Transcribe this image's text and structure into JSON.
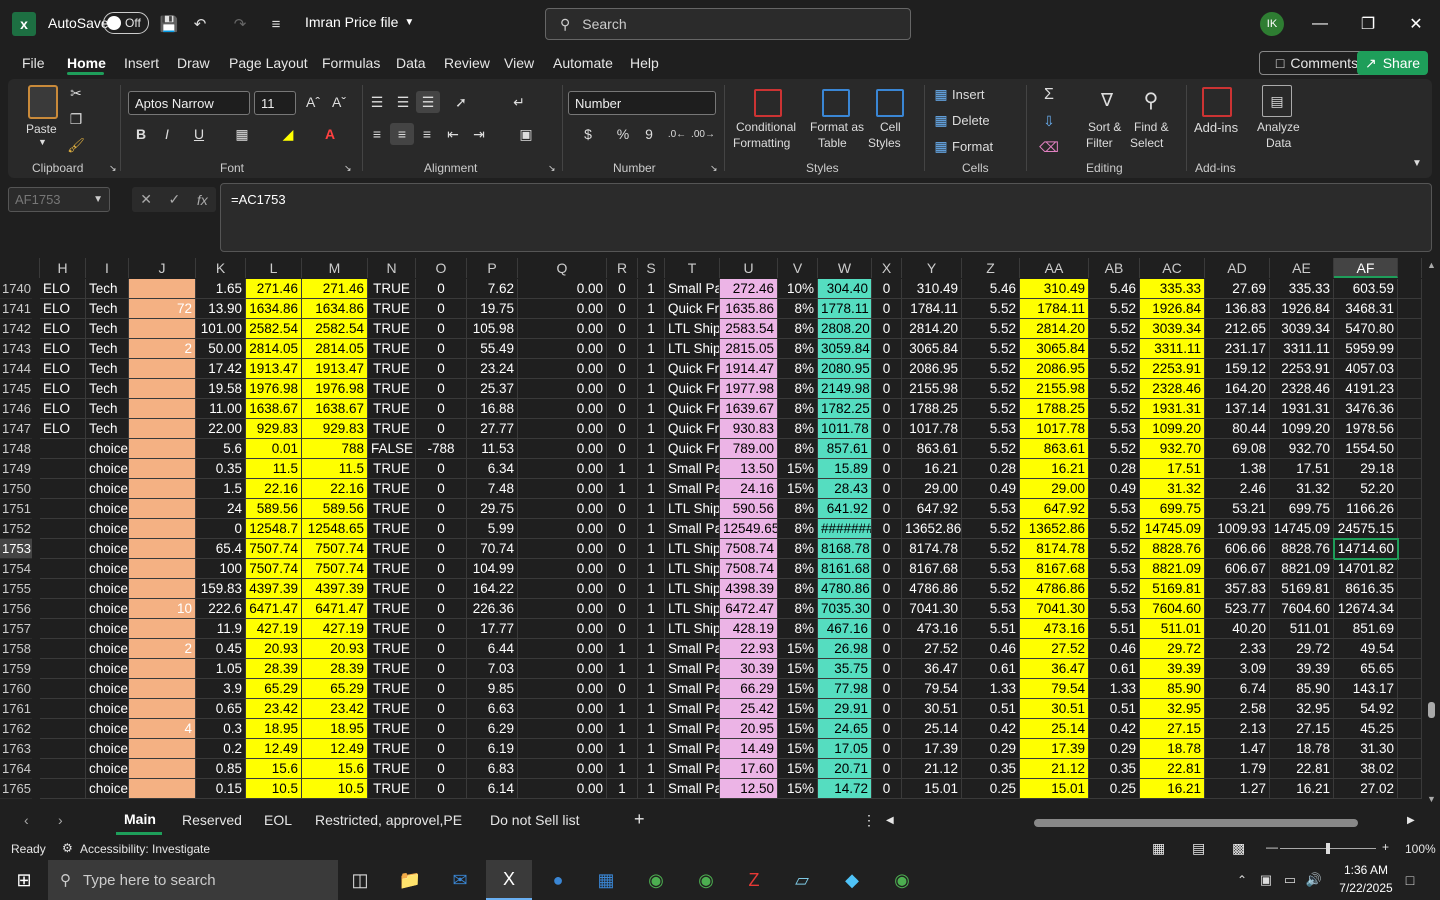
{
  "titlebar": {
    "autosave_label": "AutoSave",
    "autosave_state": "Off",
    "file_name": "Imran Price file",
    "search_placeholder": "Search",
    "user_initials": "IK"
  },
  "menu": {
    "items": [
      "File",
      "Home",
      "Insert",
      "Draw",
      "Page Layout",
      "Formulas",
      "Data",
      "Review",
      "View",
      "Automate",
      "Help"
    ],
    "active": "Home",
    "comments": "Comments",
    "share": "Share"
  },
  "ribbon": {
    "clipboard": {
      "paste": "Paste",
      "group": "Clipboard"
    },
    "font": {
      "name": "Aptos Narrow",
      "size": "11",
      "group": "Font"
    },
    "alignment": {
      "group": "Alignment"
    },
    "number": {
      "format": "Number",
      "group": "Number"
    },
    "styles": {
      "conditional": "Conditional",
      "conditional2": "Formatting",
      "format_as": "Format as",
      "format_as2": "Table",
      "cell": "Cell",
      "cell2": "Styles",
      "group": "Styles"
    },
    "cells": {
      "insert": "Insert",
      "delete": "Delete",
      "format": "Format",
      "group": "Cells"
    },
    "editing": {
      "sort": "Sort &",
      "sort2": "Filter",
      "find": "Find &",
      "find2": "Select",
      "group": "Editing"
    },
    "addins": {
      "addins": "Add-ins",
      "analyze": "Analyze",
      "analyze2": "Data",
      "group": "Add-ins"
    }
  },
  "formula_bar": {
    "name_box": "AF1753",
    "formula": "=AC1753"
  },
  "grid": {
    "columns": [
      "H",
      "I",
      "J",
      "K",
      "L",
      "M",
      "N",
      "O",
      "P",
      "Q",
      "R",
      "S",
      "T",
      "U",
      "V",
      "W",
      "X",
      "Y",
      "Z",
      "AA",
      "AB",
      "AC",
      "AD",
      "AE",
      "AF"
    ],
    "selected_column": "AF",
    "selected_row": "1753",
    "rows": [
      {
        "n": "1740",
        "c": [
          "ELO",
          "Tech",
          "",
          "1.65",
          "271.46",
          "271.46",
          "TRUE",
          "0",
          "7.62",
          "0.00",
          "0",
          "1",
          "Small Pa",
          "272.46",
          "10%",
          "304.40",
          "0",
          "310.49",
          "5.46",
          "310.49",
          "5.46",
          "335.33",
          "27.69",
          "335.33",
          "603.59"
        ]
      },
      {
        "n": "1741",
        "c": [
          "ELO",
          "Tech",
          "72",
          "13.90",
          "1634.86",
          "1634.86",
          "TRUE",
          "0",
          "19.75",
          "0.00",
          "0",
          "1",
          "Quick Fr",
          "1635.86",
          "8%",
          "1778.11",
          "0",
          "1784.11",
          "5.52",
          "1784.11",
          "5.52",
          "1926.84",
          "136.83",
          "1926.84",
          "3468.31"
        ]
      },
      {
        "n": "1742",
        "c": [
          "ELO",
          "Tech",
          "",
          "101.00",
          "2582.54",
          "2582.54",
          "TRUE",
          "0",
          "105.98",
          "0.00",
          "0",
          "1",
          "LTL Ship",
          "2583.54",
          "8%",
          "2808.20",
          "0",
          "2814.20",
          "5.52",
          "2814.20",
          "5.52",
          "3039.34",
          "212.65",
          "3039.34",
          "5470.80"
        ]
      },
      {
        "n": "1743",
        "c": [
          "ELO",
          "Tech",
          "2",
          "50.00",
          "2814.05",
          "2814.05",
          "TRUE",
          "0",
          "55.49",
          "0.00",
          "0",
          "1",
          "LTL Ship",
          "2815.05",
          "8%",
          "3059.84",
          "0",
          "3065.84",
          "5.52",
          "3065.84",
          "5.52",
          "3311.11",
          "231.17",
          "3311.11",
          "5959.99"
        ]
      },
      {
        "n": "1744",
        "c": [
          "ELO",
          "Tech",
          "",
          "17.42",
          "1913.47",
          "1913.47",
          "TRUE",
          "0",
          "23.24",
          "0.00",
          "0",
          "1",
          "Quick Fr",
          "1914.47",
          "8%",
          "2080.95",
          "0",
          "2086.95",
          "5.52",
          "2086.95",
          "5.52",
          "2253.91",
          "159.12",
          "2253.91",
          "4057.03"
        ]
      },
      {
        "n": "1745",
        "c": [
          "ELO",
          "Tech",
          "",
          "19.58",
          "1976.98",
          "1976.98",
          "TRUE",
          "0",
          "25.37",
          "0.00",
          "0",
          "1",
          "Quick Fr",
          "1977.98",
          "8%",
          "2149.98",
          "0",
          "2155.98",
          "5.52",
          "2155.98",
          "5.52",
          "2328.46",
          "164.20",
          "2328.46",
          "4191.23"
        ]
      },
      {
        "n": "1746",
        "c": [
          "ELO",
          "Tech",
          "",
          "11.00",
          "1638.67",
          "1638.67",
          "TRUE",
          "0",
          "16.88",
          "0.00",
          "0",
          "1",
          "Quick Fr",
          "1639.67",
          "8%",
          "1782.25",
          "0",
          "1788.25",
          "5.52",
          "1788.25",
          "5.52",
          "1931.31",
          "137.14",
          "1931.31",
          "3476.36"
        ]
      },
      {
        "n": "1747",
        "c": [
          "ELO",
          "Tech",
          "",
          "22.00",
          "929.83",
          "929.83",
          "TRUE",
          "0",
          "27.77",
          "0.00",
          "0",
          "1",
          "Quick Fr",
          "930.83",
          "8%",
          "1011.78",
          "0",
          "1017.78",
          "5.53",
          "1017.78",
          "5.53",
          "1099.20",
          "80.44",
          "1099.20",
          "1978.56"
        ]
      },
      {
        "n": "1748",
        "c": [
          "",
          "choice",
          "",
          "5.6",
          "0.01",
          "788",
          "FALSE",
          "-788",
          "11.53",
          "0.00",
          "0",
          "1",
          "Quick Fr",
          "789.00",
          "8%",
          "857.61",
          "0",
          "863.61",
          "5.52",
          "863.61",
          "5.52",
          "932.70",
          "69.08",
          "932.70",
          "1554.50"
        ]
      },
      {
        "n": "1749",
        "c": [
          "",
          "choice",
          "",
          "0.35",
          "11.5",
          "11.5",
          "TRUE",
          "0",
          "6.34",
          "0.00",
          "1",
          "1",
          "Small Pa",
          "13.50",
          "15%",
          "15.89",
          "0",
          "16.21",
          "0.28",
          "16.21",
          "0.28",
          "17.51",
          "1.38",
          "17.51",
          "29.18"
        ]
      },
      {
        "n": "1750",
        "c": [
          "",
          "choice",
          "",
          "1.5",
          "22.16",
          "22.16",
          "TRUE",
          "0",
          "7.48",
          "0.00",
          "1",
          "1",
          "Small Pa",
          "24.16",
          "15%",
          "28.43",
          "0",
          "29.00",
          "0.49",
          "29.00",
          "0.49",
          "31.32",
          "2.46",
          "31.32",
          "52.20"
        ]
      },
      {
        "n": "1751",
        "c": [
          "",
          "choice",
          "",
          "24",
          "589.56",
          "589.56",
          "TRUE",
          "0",
          "29.75",
          "0.00",
          "0",
          "1",
          "LTL Ship",
          "590.56",
          "8%",
          "641.92",
          "0",
          "647.92",
          "5.53",
          "647.92",
          "5.53",
          "699.75",
          "53.21",
          "699.75",
          "1166.26"
        ]
      },
      {
        "n": "1752",
        "c": [
          "",
          "choice",
          "",
          "0",
          "12548.7",
          "12548.65",
          "TRUE",
          "0",
          "5.99",
          "0.00",
          "0",
          "1",
          "Small Pa",
          "12549.65",
          "8%",
          "#######",
          "0",
          "13652.86",
          "5.52",
          "13652.86",
          "5.52",
          "14745.09",
          "1009.93",
          "14745.09",
          "24575.15"
        ]
      },
      {
        "n": "1753",
        "c": [
          "",
          "choice",
          "",
          "65.4",
          "7507.74",
          "7507.74",
          "TRUE",
          "0",
          "70.74",
          "0.00",
          "0",
          "1",
          "LTL Ship",
          "7508.74",
          "8%",
          "8168.78",
          "0",
          "8174.78",
          "5.52",
          "8174.78",
          "5.52",
          "8828.76",
          "606.66",
          "8828.76",
          "14714.60"
        ]
      },
      {
        "n": "1754",
        "c": [
          "",
          "choice",
          "",
          "100",
          "7507.74",
          "7507.74",
          "TRUE",
          "0",
          "104.99",
          "0.00",
          "0",
          "1",
          "LTL Ship",
          "7508.74",
          "8%",
          "8161.68",
          "0",
          "8167.68",
          "5.53",
          "8167.68",
          "5.53",
          "8821.09",
          "606.67",
          "8821.09",
          "14701.82"
        ]
      },
      {
        "n": "1755",
        "c": [
          "",
          "choice",
          "",
          "159.83",
          "4397.39",
          "4397.39",
          "TRUE",
          "0",
          "164.22",
          "0.00",
          "0",
          "1",
          "LTL Ship",
          "4398.39",
          "8%",
          "4780.86",
          "0",
          "4786.86",
          "5.52",
          "4786.86",
          "5.52",
          "5169.81",
          "357.83",
          "5169.81",
          "8616.35"
        ]
      },
      {
        "n": "1756",
        "c": [
          "",
          "choice",
          "10",
          "222.6",
          "6471.47",
          "6471.47",
          "TRUE",
          "0",
          "226.36",
          "0.00",
          "0",
          "1",
          "LTL Ship",
          "6472.47",
          "8%",
          "7035.30",
          "0",
          "7041.30",
          "5.53",
          "7041.30",
          "5.53",
          "7604.60",
          "523.77",
          "7604.60",
          "12674.34"
        ]
      },
      {
        "n": "1757",
        "c": [
          "",
          "choice",
          "",
          "11.9",
          "427.19",
          "427.19",
          "TRUE",
          "0",
          "17.77",
          "0.00",
          "0",
          "1",
          "LTL Ship",
          "428.19",
          "8%",
          "467.16",
          "0",
          "473.16",
          "5.51",
          "473.16",
          "5.51",
          "511.01",
          "40.20",
          "511.01",
          "851.69"
        ]
      },
      {
        "n": "1758",
        "c": [
          "",
          "choice",
          "2",
          "0.45",
          "20.93",
          "20.93",
          "TRUE",
          "0",
          "6.44",
          "0.00",
          "1",
          "1",
          "Small Pa",
          "22.93",
          "15%",
          "26.98",
          "0",
          "27.52",
          "0.46",
          "27.52",
          "0.46",
          "29.72",
          "2.33",
          "29.72",
          "49.54"
        ]
      },
      {
        "n": "1759",
        "c": [
          "",
          "choice",
          "",
          "1.05",
          "28.39",
          "28.39",
          "TRUE",
          "0",
          "7.03",
          "0.00",
          "1",
          "1",
          "Small Pa",
          "30.39",
          "15%",
          "35.75",
          "0",
          "36.47",
          "0.61",
          "36.47",
          "0.61",
          "39.39",
          "3.09",
          "39.39",
          "65.65"
        ]
      },
      {
        "n": "1760",
        "c": [
          "",
          "choice",
          "",
          "3.9",
          "65.29",
          "65.29",
          "TRUE",
          "0",
          "9.85",
          "0.00",
          "0",
          "1",
          "Small Pa",
          "66.29",
          "15%",
          "77.98",
          "0",
          "79.54",
          "1.33",
          "79.54",
          "1.33",
          "85.90",
          "6.74",
          "85.90",
          "143.17"
        ]
      },
      {
        "n": "1761",
        "c": [
          "",
          "choice",
          "",
          "0.65",
          "23.42",
          "23.42",
          "TRUE",
          "0",
          "6.63",
          "0.00",
          "1",
          "1",
          "Small Pa",
          "25.42",
          "15%",
          "29.91",
          "0",
          "30.51",
          "0.51",
          "30.51",
          "0.51",
          "32.95",
          "2.58",
          "32.95",
          "54.92"
        ]
      },
      {
        "n": "1762",
        "c": [
          "",
          "choice",
          "4",
          "0.3",
          "18.95",
          "18.95",
          "TRUE",
          "0",
          "6.29",
          "0.00",
          "1",
          "1",
          "Small Pa",
          "20.95",
          "15%",
          "24.65",
          "0",
          "25.14",
          "0.42",
          "25.14",
          "0.42",
          "27.15",
          "2.13",
          "27.15",
          "45.25"
        ]
      },
      {
        "n": "1763",
        "c": [
          "",
          "choice",
          "",
          "0.2",
          "12.49",
          "12.49",
          "TRUE",
          "0",
          "6.19",
          "0.00",
          "1",
          "1",
          "Small Pa",
          "14.49",
          "15%",
          "17.05",
          "0",
          "17.39",
          "0.29",
          "17.39",
          "0.29",
          "18.78",
          "1.47",
          "18.78",
          "31.30"
        ]
      },
      {
        "n": "1764",
        "c": [
          "",
          "choice",
          "",
          "0.85",
          "15.6",
          "15.6",
          "TRUE",
          "0",
          "6.83",
          "0.00",
          "1",
          "1",
          "Small Pa",
          "17.60",
          "15%",
          "20.71",
          "0",
          "21.12",
          "0.35",
          "21.12",
          "0.35",
          "22.81",
          "1.79",
          "22.81",
          "38.02"
        ]
      },
      {
        "n": "1765",
        "c": [
          "",
          "choice",
          "",
          "0.15",
          "10.5",
          "10.5",
          "TRUE",
          "0",
          "6.14",
          "0.00",
          "1",
          "1",
          "Small Pa",
          "12.50",
          "15%",
          "14.72",
          "0",
          "15.01",
          "0.25",
          "15.01",
          "0.25",
          "16.21",
          "1.27",
          "16.21",
          "27.02"
        ]
      }
    ]
  },
  "sheet_tabs": {
    "tabs": [
      "Main",
      "Reserved",
      "EOL",
      "Restricted, approvel,PE",
      "Do not Sell list"
    ],
    "active": "Main"
  },
  "status": {
    "ready": "Ready",
    "accessibility": "Accessibility: Investigate",
    "zoom": "100%"
  },
  "taskbar": {
    "search_placeholder": "Type here to search",
    "time": "1:36 AM",
    "date": "7/22/2025"
  },
  "colors": {
    "accent": "#1e9e5a",
    "peach": "#f4b183",
    "yellow": "#ffff00",
    "pink": "#ecb4e6",
    "teal": "#55ddc0"
  }
}
